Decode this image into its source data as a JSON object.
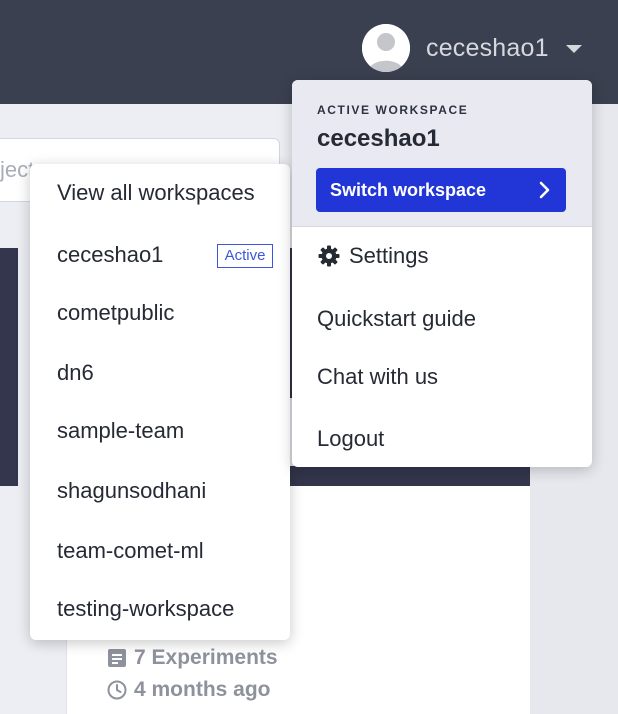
{
  "header": {
    "username": "ceceshao1",
    "avatar_icon": "user-avatar-icon",
    "caret_icon": "caret-down-icon"
  },
  "background": {
    "search_placeholder": "ject",
    "project_card": {
      "experiments": "7 Experiments",
      "updated": "4 months ago"
    }
  },
  "workspace_menu": {
    "view_all": "View all workspaces",
    "active_badge": "Active",
    "items": [
      "ceceshao1",
      "cometpublic",
      "dn6",
      "sample-team",
      "shagunsodhani",
      "team-comet-ml",
      "testing-workspace"
    ]
  },
  "account_menu": {
    "active_label": "ACTIVE WORKSPACE",
    "active_name": "ceceshao1",
    "switch_label": "Switch workspace",
    "settings": "Settings",
    "quickstart": "Quickstart guide",
    "chat": "Chat with us",
    "logout": "Logout"
  },
  "colors": {
    "topbar": "#3b4050",
    "accent": "#2235d6",
    "badge": "#3a56e0"
  }
}
